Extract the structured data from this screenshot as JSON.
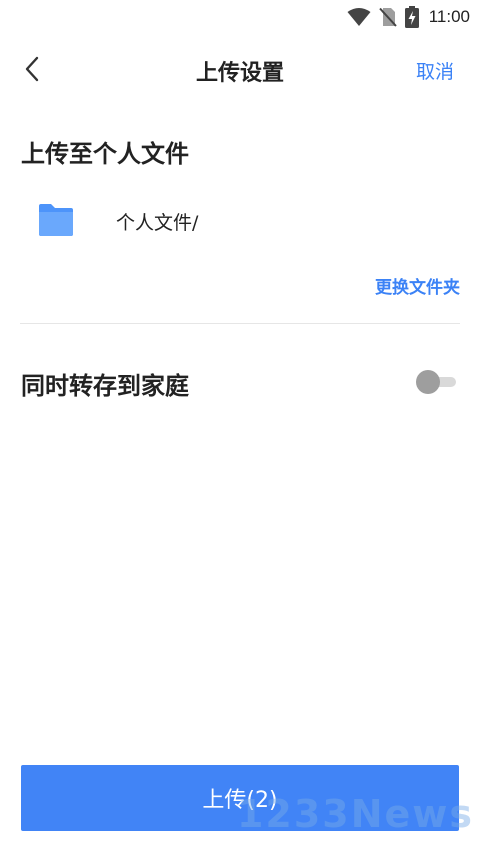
{
  "status_bar": {
    "time": "11:00",
    "icons": [
      "wifi-icon",
      "no-sim-icon",
      "battery-charging-icon"
    ]
  },
  "header": {
    "back_icon": "chevron-left-icon",
    "title": "上传设置",
    "cancel_label": "取消"
  },
  "destination": {
    "heading": "上传至个人文件",
    "folder_icon": "folder-icon",
    "folder_path": "个人文件/",
    "change_label": "更换文件夹"
  },
  "family": {
    "label": "同时转存到家庭",
    "toggle_on": false
  },
  "footer": {
    "upload_label": "上传(2)"
  },
  "watermark": {
    "text": "1233News"
  },
  "colors": {
    "accent": "#3b82f6",
    "button": "#4184f6",
    "folder": "#4d94fa"
  }
}
